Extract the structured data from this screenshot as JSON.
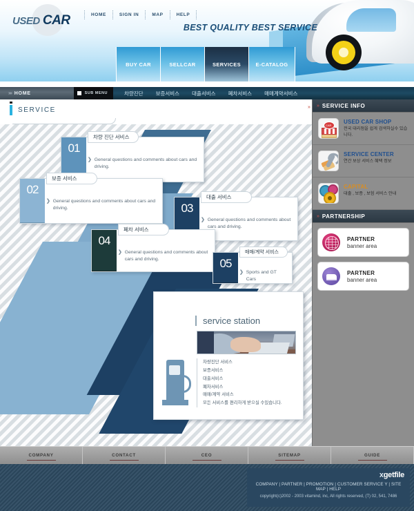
{
  "header": {
    "logo": {
      "word1": "USED",
      "word2": "CAR"
    },
    "topnav": [
      "HOME",
      "SIGN IN",
      "MAP",
      "HELP"
    ],
    "tagline": "BEST QUALITY BEST SERVICE"
  },
  "maintabs": [
    {
      "label": "BUY CAR",
      "active": false
    },
    {
      "label": "SELLCAR",
      "active": false
    },
    {
      "label": "SERVICES",
      "active": true
    },
    {
      "label": "E-CATALOG",
      "active": false
    }
  ],
  "submenu": {
    "home_label": "HOME",
    "sub_button": "SUB MENU",
    "items": [
      "차량진단",
      "보증서비스",
      "대출서비스",
      "폐차서비스",
      "매매계약서비스"
    ]
  },
  "page_title": "SERVICE",
  "cards": [
    {
      "num": "01",
      "badge": "차량 진단 서비스",
      "desc": "General questions and comments about cars and driving."
    },
    {
      "num": "02",
      "badge": "보증 서비스",
      "desc": "General questions and comments about cars and driving."
    },
    {
      "num": "03",
      "badge": "대출 서비스",
      "desc": "General questions and comments about cars and driving."
    },
    {
      "num": "04",
      "badge": "폐차 서비스",
      "desc": "General questions and comments about cars and driving."
    },
    {
      "num": "05",
      "badge": "매매/계약 서비스",
      "desc": "Sports and GT Cars"
    }
  ],
  "station": {
    "title": "service station",
    "list": [
      "차량진단 서비스",
      "보증서비스",
      "대출서비스",
      "폐차서비스",
      "매매/계약 서비스",
      "모든 서비스를 편리하게 받으실 수있습니다."
    ]
  },
  "sidebar": {
    "service_info_heading": "SERVICE INFO",
    "partnership_heading": "PARTNERSHIP",
    "info_items": [
      {
        "title": "USED CAR SHOP",
        "sub": "전국 대리점을 쉽게 검색하실수 있습니다.",
        "icon": "shop-icon"
      },
      {
        "title": "SERVICE CENTER",
        "sub": "연간 보상 서비스 혜택 정보",
        "icon": "wrench-icon"
      },
      {
        "title": "CAPITAL",
        "sub": "대출 , 보증 , 보험 서비스 안내",
        "icon": "gears-icon"
      }
    ],
    "banners": [
      {
        "line1": "PARTNER",
        "line2": "banner area",
        "icon": "globe-icon"
      },
      {
        "line1": "PARTNER",
        "line2": "banner area",
        "icon": "truck-icon"
      }
    ]
  },
  "footer": {
    "nav": [
      "COMPANY",
      "CONTACT",
      "CEO",
      "SITEMAP",
      "GUIDE"
    ],
    "logo": "getfile",
    "links": "COMPANY | PARTNER | PROMOTION | CUSTOMER SERVICE Y | SITE MAP | HELP",
    "copyright": "copyright(c)2002 - 2003 vitamind, inc,  All rights reserved, (T) 02, 541, 7486"
  },
  "colors": {
    "accent_blue": "#1f4f8f",
    "accent_orange": "#d98d22",
    "dark_navy": "#1d4063",
    "tab_active": "#1b2f44"
  }
}
